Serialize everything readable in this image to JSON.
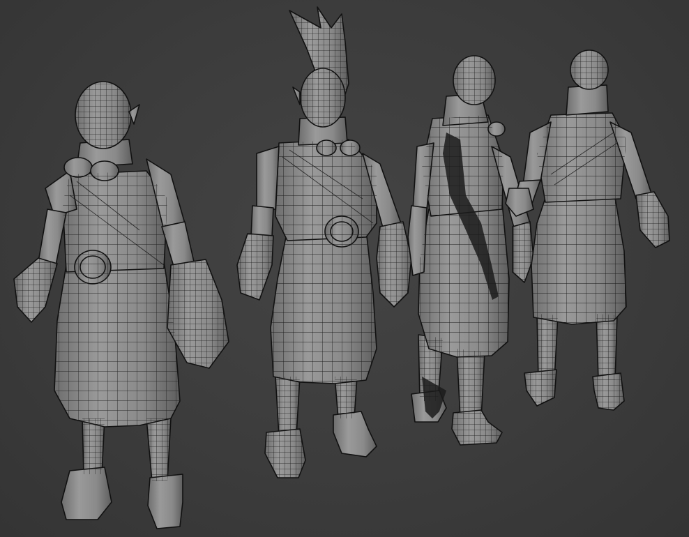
{
  "scene": {
    "background_color": "#3b3b3b",
    "material_color": "#8e8e8e",
    "wire_color": "#1a1a1a",
    "figures": [
      {
        "label": "front-three-quarter-view"
      },
      {
        "label": "front-view-with-tall-hair"
      },
      {
        "label": "back-three-quarter-view"
      },
      {
        "label": "back-view"
      }
    ]
  }
}
